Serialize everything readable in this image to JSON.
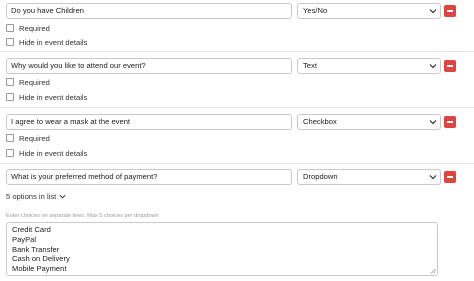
{
  "questions": [
    {
      "label": "Do you have Children",
      "type": "Yes/No",
      "required_label": "Required",
      "hide_label": "Hide in event details"
    },
    {
      "label": "Why would you like to attend our event?",
      "type": "Text",
      "required_label": "Required",
      "hide_label": "Hide in event details"
    },
    {
      "label": "I agree to wear a mask at the event",
      "type": "Checkbox",
      "required_label": "Required",
      "hide_label": "Hide in event details"
    },
    {
      "label": "What is your preferred method of payment?",
      "type": "Dropdown"
    }
  ],
  "dropdown": {
    "options_count_label": "5 options in list",
    "hint": "Enter choices on separate lines. Max 5 choices per dropdown",
    "choices": [
      "Credit Card",
      "PayPal",
      "Bank Transfer",
      "Cash on Delivery",
      "Mobile Payment"
    ]
  },
  "icons": {
    "select_arrow": "chevron-down-icon",
    "delete": "minus-icon",
    "resize": "resize-grip-icon"
  },
  "colors": {
    "delete_button": "#e0443e",
    "border": "#c9c9c9",
    "hint_text": "#9a9a9a"
  }
}
